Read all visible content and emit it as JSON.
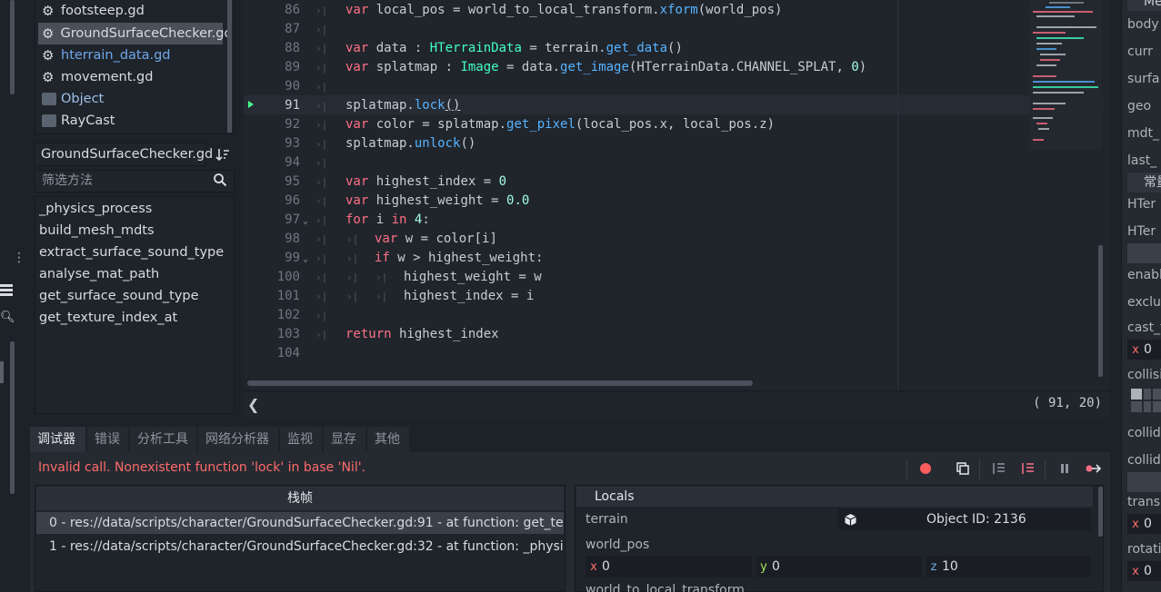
{
  "files": [
    {
      "name": "footsteep.gd",
      "icon": "gear-icon"
    },
    {
      "name": "GroundSurfaceChecker.gd",
      "icon": "gear-icon",
      "selected": true
    },
    {
      "name": "hterrain_data.gd",
      "icon": "gear-icon",
      "link": true
    },
    {
      "name": "movement.gd",
      "icon": "gear-icon"
    },
    {
      "name": "Object",
      "icon": "doc-icon"
    },
    {
      "name": "RayCast",
      "icon": "doc-icon"
    }
  ],
  "script_name": "GroundSurfaceChecker.gd",
  "filter_placeholder": "筛选方法",
  "methods": [
    "_physics_process",
    "build_mesh_mdts",
    "extract_surface_sound_type",
    "analyse_mat_path",
    "get_surface_sound_type",
    "get_texture_index_at"
  ],
  "code": {
    "line_numbers": [
      "86",
      "87",
      "88",
      "89",
      "90",
      "91",
      "92",
      "93",
      "94",
      "95",
      "96",
      "97",
      "98",
      "99",
      "100",
      "101",
      "102",
      "103",
      "104"
    ],
    "current_line": "91",
    "lines": {
      "l86": {
        "kw": "var",
        "rest1": " local_pos = world_to_local_transform.",
        "fn": "xform",
        "rest2": "(world_pos)"
      },
      "l88": {
        "kw": "var",
        "rest1": " data : ",
        "ty": "HTerrainData",
        "rest2": " = terrain.",
        "fn": "get_data",
        "rest3": "()"
      },
      "l89": {
        "kw": "var",
        "rest1": " splatmap : ",
        "ty": "Image",
        "rest2": " = data.",
        "fn": "get_image",
        "rest3": "(HTerrainData.CHANNEL_SPLAT, ",
        "num": "0",
        "rest4": ")"
      },
      "l91": {
        "rest1": "splatmap.",
        "fn": "lock",
        "rest2": "()"
      },
      "l92": {
        "kw": "var",
        "rest1": " color = splatmap.",
        "fn": "get_pixel",
        "rest2": "(local_pos.x, local_pos.z)"
      },
      "l93": {
        "rest1": "splatmap.",
        "fn": "unlock",
        "rest2": "()"
      },
      "l95": {
        "kw": "var",
        "rest1": " highest_index = ",
        "num": "0"
      },
      "l96": {
        "kw": "var",
        "rest1": " highest_weight = ",
        "num": "0.0"
      },
      "l97": {
        "kw": "for",
        "rest1": " i ",
        "kw2": "in",
        "rest2": " ",
        "num": "4",
        "rest3": ":"
      },
      "l98": {
        "kw": "var",
        "rest1": " w = color[i]"
      },
      "l99": {
        "kw": "if",
        "rest1": " w > highest_weight:"
      },
      "l100": {
        "rest1": "highest_weight = w"
      },
      "l101": {
        "rest1": "highest_index = i"
      },
      "l103": {
        "kw": "return",
        "rest1": " highest_index"
      }
    }
  },
  "cursor_position": "( 91, 20)",
  "debugger": {
    "tabs": [
      "调试器",
      "错误",
      "分析工具",
      "网络分析器",
      "监视",
      "显存",
      "其他"
    ],
    "error": "Invalid call. Nonexistent function 'lock' in base 'Nil'.",
    "stack_header": "栈帧",
    "stack": [
      "0 - res://data/scripts/character/GroundSurfaceChecker.gd:91 - at function: get_texture_index_at",
      "1 - res://data/scripts/character/GroundSurfaceChecker.gd:32 - at function: _physics_process"
    ],
    "locals_header": "Locals",
    "terrain_label": "terrain",
    "terrain_value": "Object ID: 2136",
    "world_pos_label": "world_pos",
    "world_pos": {
      "x": "0",
      "y": "0",
      "z": "10"
    },
    "next_label": "world_to_local_transform"
  },
  "inspector": {
    "top": "Me",
    "props1": [
      "body",
      "curr",
      "surfa",
      "geo",
      "mdt_",
      "last_"
    ],
    "section": "常量",
    "props2": [
      "HTer",
      "HTer"
    ],
    "props3": [
      "enabl",
      "exclu",
      "cast_t"
    ],
    "cast_x": "0",
    "collision": "collisi",
    "props4": [
      "collid",
      "collid"
    ],
    "transl": "transl",
    "transl_x": "0",
    "rotati": "rotati",
    "rot_x": "0",
    "axis_labels": {
      "x": "x",
      "y": "y",
      "z": "z"
    }
  },
  "colors": {
    "keyword": "#ff7085",
    "function": "#57b3ff",
    "type": "#42ffc2",
    "number": "#a1ffe0",
    "error": "#ff6b6b"
  }
}
